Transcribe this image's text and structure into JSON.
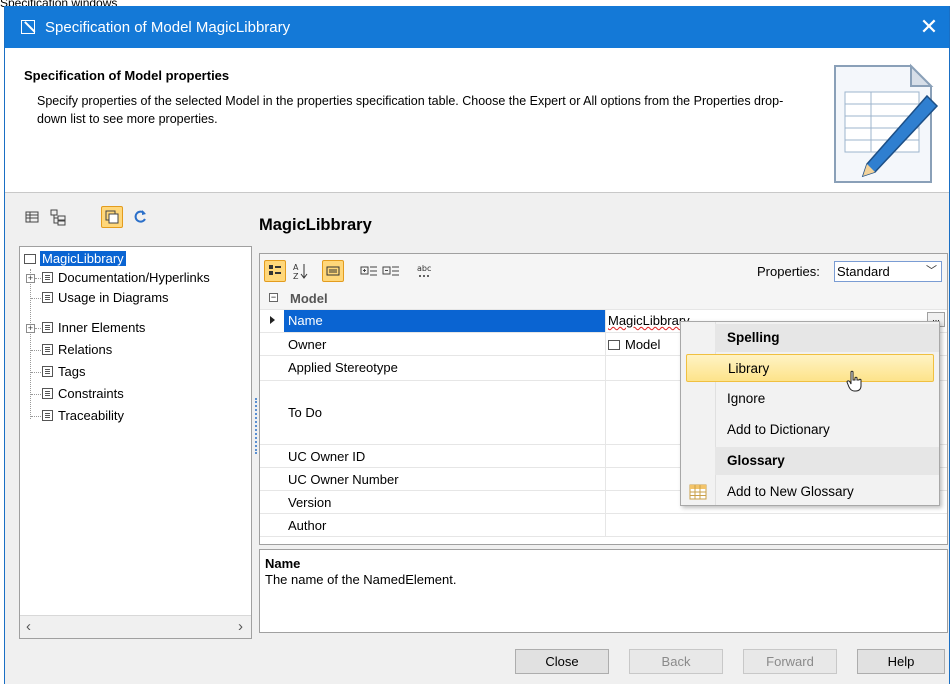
{
  "caption": "Specification windows",
  "window": {
    "title": "Specification of Model MagicLibbrary",
    "close_glyph": "✕"
  },
  "header": {
    "title": "Specification of Model properties",
    "description": "Specify properties of the selected Model in the properties specification table. Choose the Expert or All options from the Properties drop-down list to see more properties.",
    "icon": "document-pencil-icon"
  },
  "panel_title": "MagicLibbrary",
  "tree": {
    "items": [
      {
        "label": "MagicLibbrary",
        "selected": true,
        "icon": "model-icon"
      },
      {
        "label": "Documentation/Hyperlinks",
        "expandable": true
      },
      {
        "label": "Usage in Diagrams"
      },
      {
        "label": "Inner Elements",
        "expandable": true
      },
      {
        "label": "Relations"
      },
      {
        "label": "Tags"
      },
      {
        "label": "Constraints"
      },
      {
        "label": "Traceability"
      }
    ]
  },
  "properties": {
    "filter_label": "Properties:",
    "filter_value": "Standard",
    "group": "Model",
    "rows": [
      {
        "key": "Name",
        "value": "MagicLibbrary",
        "selected": true
      },
      {
        "key": "Owner",
        "value": "Model"
      },
      {
        "key": "Applied Stereotype",
        "value": ""
      },
      {
        "key": "To Do",
        "value": ""
      },
      {
        "key": "UC Owner ID",
        "value": ""
      },
      {
        "key": "UC Owner Number",
        "value": ""
      },
      {
        "key": "Version",
        "value": ""
      },
      {
        "key": "Author",
        "value": ""
      }
    ],
    "ellipsis": "..."
  },
  "description": {
    "title": "Name",
    "text": "The name of the NamedElement."
  },
  "buttons": {
    "close": "Close",
    "back": "Back",
    "forward": "Forward",
    "help": "Help"
  },
  "context_menu": {
    "spelling_header": "Spelling",
    "suggestion": "Library",
    "ignore": "Ignore",
    "add_dictionary": "Add to Dictionary",
    "glossary_header": "Glossary",
    "add_glossary": "Add to New Glossary"
  },
  "colors": {
    "titlebar": "#1479d7",
    "selection": "#0a64d2",
    "highlight": "#fde38a"
  }
}
